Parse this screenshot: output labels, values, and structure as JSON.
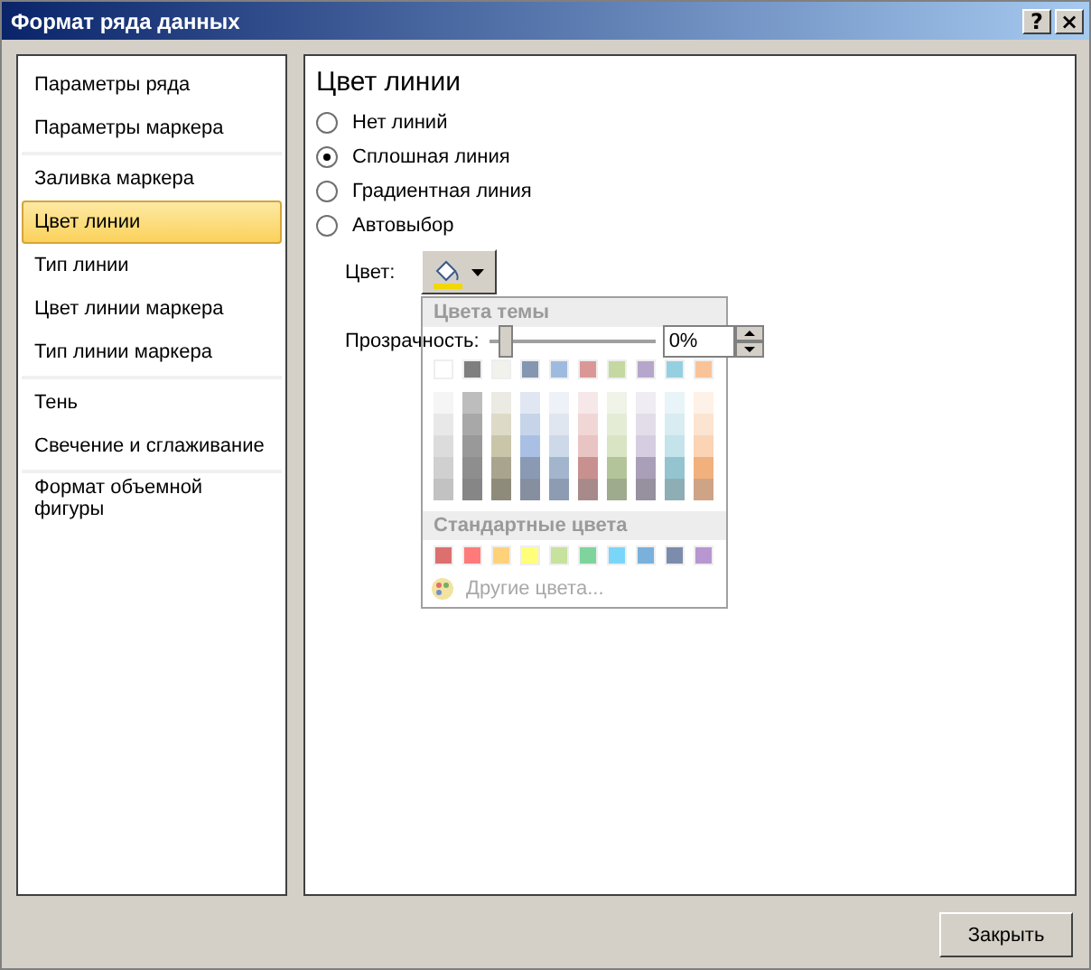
{
  "window": {
    "title": "Формат ряда данных",
    "help_button": "?",
    "close_button": "×"
  },
  "sidebar": {
    "groups": [
      {
        "items": [
          {
            "label": "Параметры ряда",
            "selected": false
          },
          {
            "label": "Параметры маркера",
            "selected": false
          }
        ]
      },
      {
        "items": [
          {
            "label": "Заливка маркера",
            "selected": false
          },
          {
            "label": "Цвет линии",
            "selected": true
          },
          {
            "label": "Тип линии",
            "selected": false
          },
          {
            "label": "Цвет линии маркера",
            "selected": false
          },
          {
            "label": "Тип линии маркера",
            "selected": false
          }
        ]
      },
      {
        "items": [
          {
            "label": "Тень",
            "selected": false
          },
          {
            "label": "Свечение и сглаживание",
            "selected": false
          }
        ]
      },
      {
        "items": [
          {
            "label": "Формат объемной фигуры",
            "selected": false
          }
        ]
      }
    ]
  },
  "panel": {
    "title": "Цвет линии",
    "options": [
      {
        "label": "Нет линий",
        "selected": false
      },
      {
        "label": "Сплошная линия",
        "selected": true
      },
      {
        "label": "Градиентная линия",
        "selected": false
      },
      {
        "label": "Автовыбор",
        "selected": false
      }
    ],
    "color_label": "Цвет:",
    "transparency_label": "Прозрачность:",
    "transparency": {
      "level": 0.05,
      "value": "0%"
    }
  },
  "color_popup": {
    "theme_title": "Цвета темы",
    "theme_colors": [
      {
        "color": "#ffffff",
        "shades": [
          {
            "color": "#f5f5f5"
          },
          {
            "color": "#e8e8e8"
          },
          {
            "color": "#dcdcdc"
          },
          {
            "color": "#d0d0d0"
          },
          {
            "color": "#c2c2c2"
          }
        ]
      },
      {
        "color": "#7f7f7f",
        "shades": [
          {
            "color": "#bdbdbd"
          },
          {
            "color": "#a8a8a8"
          },
          {
            "color": "#999999"
          },
          {
            "color": "#8e8e8e"
          },
          {
            "color": "#868686"
          }
        ]
      },
      {
        "color": "#f2f2ec",
        "shades": [
          {
            "color": "#ecebe3"
          },
          {
            "color": "#dddac8"
          },
          {
            "color": "#c9c5a9"
          },
          {
            "color": "#a8a48e"
          },
          {
            "color": "#8e8b7b"
          }
        ]
      },
      {
        "color": "#8496b0",
        "shades": [
          {
            "color": "#e0e7f2"
          },
          {
            "color": "#c6d4ea"
          },
          {
            "color": "#a9c0e4"
          },
          {
            "color": "#8a9ab5"
          },
          {
            "color": "#868fa0"
          }
        ]
      },
      {
        "color": "#9ebbdf",
        "shades": [
          {
            "color": "#eef2f8"
          },
          {
            "color": "#dfe6f0"
          },
          {
            "color": "#cdd9e8"
          },
          {
            "color": "#a2b5cd"
          },
          {
            "color": "#8d9cb2"
          }
        ]
      },
      {
        "color": "#d99896",
        "shades": [
          {
            "color": "#f6e8e8"
          },
          {
            "color": "#f0d6d5"
          },
          {
            "color": "#e8c4c3"
          },
          {
            "color": "#c89190"
          },
          {
            "color": "#a98a8a"
          }
        ]
      },
      {
        "color": "#c4d8a0",
        "shades": [
          {
            "color": "#eff3e8"
          },
          {
            "color": "#e4ecd6"
          },
          {
            "color": "#d8e4c3"
          },
          {
            "color": "#b3c49a"
          },
          {
            "color": "#9eab8c"
          }
        ]
      },
      {
        "color": "#b6a6cb",
        "shades": [
          {
            "color": "#efecf3"
          },
          {
            "color": "#e3dde9"
          },
          {
            "color": "#d6cde0"
          },
          {
            "color": "#a99fb8"
          },
          {
            "color": "#97909f"
          }
        ]
      },
      {
        "color": "#95d0e0",
        "shades": [
          {
            "color": "#e8f4f7"
          },
          {
            "color": "#d8ecf1"
          },
          {
            "color": "#c4e3ea"
          },
          {
            "color": "#94c4cf"
          },
          {
            "color": "#8daeb4"
          }
        ]
      },
      {
        "color": "#fac397",
        "shades": [
          {
            "color": "#fdf1e8"
          },
          {
            "color": "#fce4d0"
          },
          {
            "color": "#fad4b5"
          },
          {
            "color": "#f2b07c"
          },
          {
            "color": "#cfa385"
          }
        ]
      }
    ],
    "standard_title": "Стандартные цвета",
    "standard_colors": [
      {
        "color": "#de6f6f"
      },
      {
        "color": "#ff7a7a"
      },
      {
        "color": "#ffd27a"
      },
      {
        "color": "#ffff7a"
      },
      {
        "color": "#c6e29c"
      },
      {
        "color": "#7ed49c"
      },
      {
        "color": "#7ad6f8"
      },
      {
        "color": "#7ab0dc"
      },
      {
        "color": "#7c8cac"
      },
      {
        "color": "#b896d0"
      }
    ],
    "more_colors": "Другие цвета..."
  },
  "footer": {
    "close_label": "Закрыть"
  }
}
